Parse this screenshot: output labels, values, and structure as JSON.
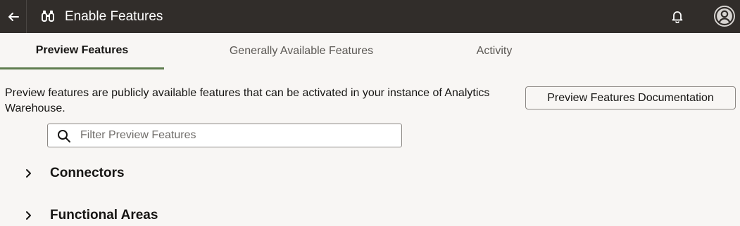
{
  "header": {
    "title": "Enable Features",
    "back_icon": "arrow-left-icon",
    "app_icon": "binoculars-icon",
    "notification_icon": "bell-icon",
    "avatar_icon": "user-avatar-icon"
  },
  "tabs": [
    {
      "label": "Preview Features",
      "active": true
    },
    {
      "label": "Generally Available Features",
      "active": false
    },
    {
      "label": "Activity",
      "active": false
    }
  ],
  "main": {
    "description": "Preview features are publicly available features that can be activated in your instance of Analytics Warehouse.",
    "doc_button_label": "Preview Features Documentation",
    "search": {
      "placeholder": "Filter Preview Features",
      "value": ""
    },
    "sections": [
      {
        "label": "Connectors",
        "expanded": false
      },
      {
        "label": "Functional Areas",
        "expanded": false
      }
    ]
  },
  "colors": {
    "header_bg": "#312d2a",
    "active_tab_underline": "#5f7d4f",
    "page_bg": "#f8f6f4"
  }
}
